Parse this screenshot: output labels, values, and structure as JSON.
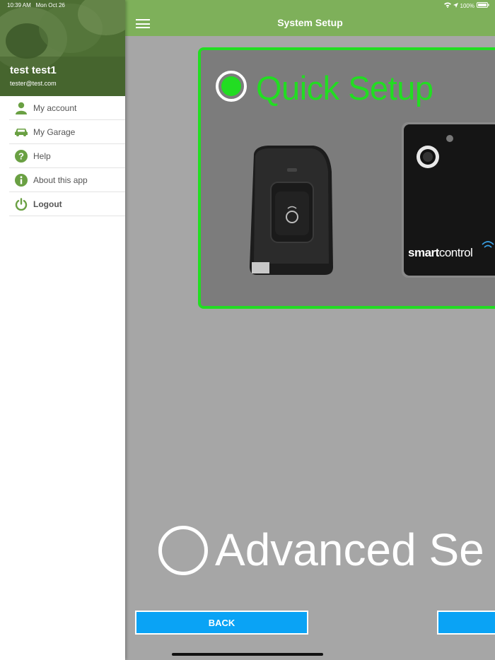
{
  "status_bar": {
    "time": "10:39 AM",
    "date": "Mon Oct 26",
    "battery": "100%"
  },
  "drawer": {
    "user_name": "test test1",
    "user_email": "tester@test.com",
    "items": [
      {
        "label": "My account",
        "icon": "person-icon"
      },
      {
        "label": "My Garage",
        "icon": "car-icon"
      },
      {
        "label": "Help",
        "icon": "help-icon"
      },
      {
        "label": "About this app",
        "icon": "info-icon"
      },
      {
        "label": "Logout",
        "icon": "power-icon"
      }
    ]
  },
  "navbar": {
    "title": "System Setup"
  },
  "options": {
    "quick": {
      "label": "Quick Setup",
      "selected": true
    },
    "advanced": {
      "label": "Advanced Se",
      "selected": false
    }
  },
  "product": {
    "brand_bold": "smart",
    "brand_rest": "control"
  },
  "buttons": {
    "back": "BACK",
    "next": ""
  },
  "colors": {
    "accent_green": "#22dd22",
    "navbar_green": "#7eb05a",
    "button_blue": "#0aa3f5",
    "menu_icon_green": "#6aa043"
  }
}
